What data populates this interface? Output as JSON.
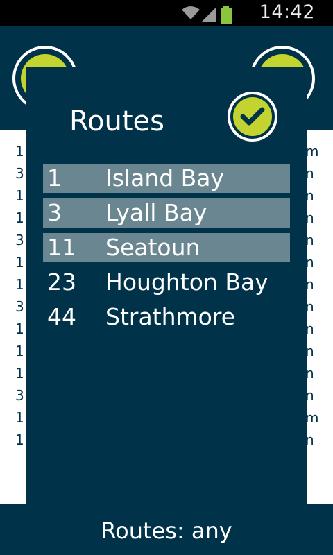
{
  "status_bar": {
    "time": "14:42",
    "icons": [
      "wifi-icon",
      "signal-icon",
      "battery-icon"
    ]
  },
  "background": {
    "header_buttons": [
      "left-round-button",
      "right-round-button"
    ],
    "list_left_fragments": [
      "1",
      "3",
      "1",
      "1",
      "3",
      "1",
      "1",
      "3",
      "1",
      "1",
      "1",
      "3",
      "1",
      "1"
    ],
    "list_right_fragments": [
      "m",
      "n",
      "n",
      "n",
      "n",
      "n",
      "n",
      "n",
      "n",
      "n",
      "n",
      "n",
      "m",
      "n"
    ],
    "footer_text": "Routes: any"
  },
  "dialog": {
    "title": "Routes",
    "routes": [
      {
        "number": "1",
        "name": "Island Bay",
        "selected": true
      },
      {
        "number": "3",
        "name": "Lyall Bay",
        "selected": true
      },
      {
        "number": "11",
        "name": "Seatoun",
        "selected": true
      },
      {
        "number": "23",
        "name": "Houghton Bay",
        "selected": false
      },
      {
        "number": "44",
        "name": "Strathmore",
        "selected": false
      }
    ]
  },
  "colors": {
    "primary": "#003249",
    "accent": "#c3d32f",
    "selected_row": "#6a8690"
  }
}
